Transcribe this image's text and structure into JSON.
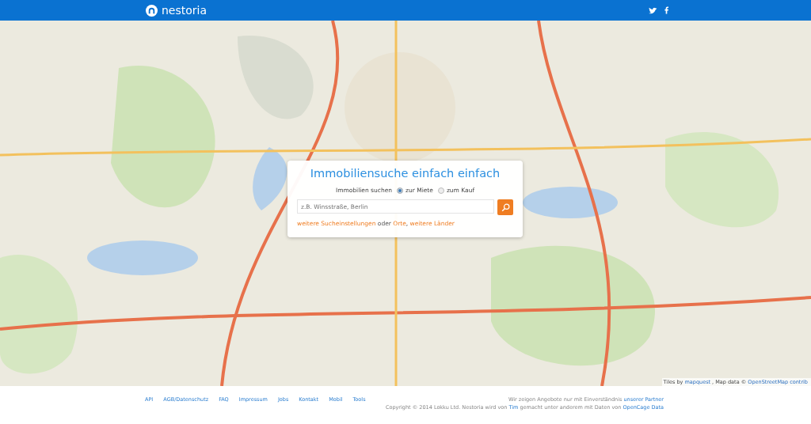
{
  "header": {
    "logo": "nestoria"
  },
  "search_card": {
    "title": "Immobiliensuche einfach einfach",
    "mode_label": "Immobilien suchen",
    "modes": [
      {
        "label": "zur Miete",
        "selected": true
      },
      {
        "label": "zum Kauf",
        "selected": false
      }
    ],
    "search": {
      "placeholder": "z.B. Winsstraße, Berlin"
    },
    "links": [
      {
        "text": "weitere Sucheinstellungen",
        "kind": "link"
      },
      {
        "text": " oder ",
        "kind": "text"
      },
      {
        "text": "Orte",
        "kind": "link"
      },
      {
        "text": ", ",
        "kind": "text"
      },
      {
        "text": "weitere Länder",
        "kind": "link"
      }
    ]
  },
  "map_attribution": [
    {
      "text": "Tiles by ",
      "kind": "text"
    },
    {
      "text": "mapquest",
      "kind": "link"
    },
    {
      "text": ", Map data © ",
      "kind": "text"
    },
    {
      "text": "OpenStreetMap contrib",
      "kind": "link"
    }
  ],
  "footer": {
    "links": [
      "API",
      "AGB/Datenschutz",
      "FAQ",
      "Impressum",
      "Jobs",
      "Kontakt",
      "Mobil",
      "Tools"
    ],
    "lines": [
      [
        {
          "text": "Wir zeigen Angebote nur mit Einverständnis ",
          "kind": "text"
        },
        {
          "text": "unserer Partner",
          "kind": "link"
        }
      ],
      [
        {
          "text": "Copyright © 2014 Lokku Ltd. Nestoria wird von ",
          "kind": "text"
        },
        {
          "text": "Tim",
          "kind": "link"
        },
        {
          "text": " gemacht unter anderem mit Daten von ",
          "kind": "text"
        },
        {
          "text": "OpenCage Data",
          "kind": "link"
        }
      ]
    ]
  }
}
